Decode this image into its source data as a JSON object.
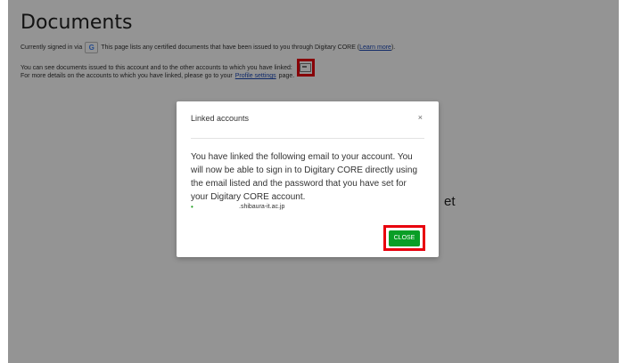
{
  "page": {
    "title": "Documents",
    "line1": {
      "prefix": "Currently signed in via",
      "provider_glyph": "G",
      "text": "This page lists any certified documents that have been issued to you through Digitary CORE (",
      "link": "Learn more",
      "suffix": ")."
    },
    "line2": {
      "text": "You can see documents issued to this account and to the other accounts to which you have linked:"
    },
    "line3": {
      "text": "For more details on the accounts to which you have linked, please go to your",
      "link": "Profile settings",
      "suffix": "page."
    },
    "background_fragment": "et"
  },
  "modal": {
    "title": "Linked accounts",
    "close_x": "×",
    "body": "You have linked the following email to your account. You will now be able to sign in to Digitary CORE directly using the email listed and the password that you have set for your Digitary CORE account.",
    "email_bullet": "•",
    "email": ".shibaura-it.ac.jp",
    "close_button": "CLOSE"
  },
  "icons": {
    "provider": "google-icon",
    "linked_accounts": "linked-accounts-icon"
  },
  "colors": {
    "overlay": "#000000",
    "close_button": "#0a9e26",
    "highlight": "#e8000d",
    "link": "#1a47b3"
  }
}
